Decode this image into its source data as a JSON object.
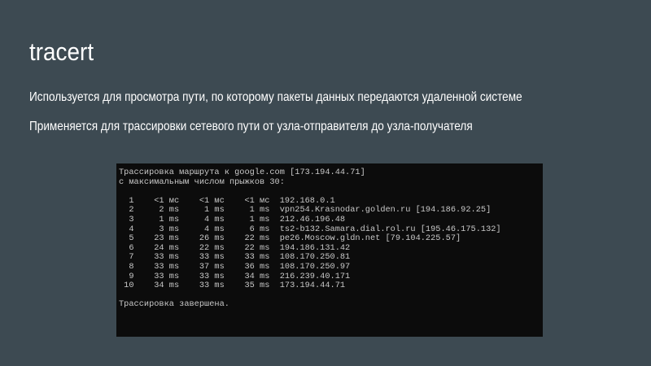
{
  "slide": {
    "title": "tracert",
    "bullets": [
      "Используется для просмотра пути, по которому пакеты данных передаются удаленной системе",
      "Применяется для трассировки сетевого пути от узла-отправителя до узла-получателя"
    ]
  },
  "console": {
    "lines": [
      "Трассировка маршрута к google.com [173.194.44.71]",
      "с максимальным числом прыжков 30:",
      "",
      "  1    <1 мс    <1 мс    <1 мс  192.168.0.1",
      "  2     2 ms     1 ms     1 ms  vpn254.Krasnodar.golden.ru [194.186.92.25]",
      "  3     1 ms     4 ms     1 ms  212.46.196.48",
      "  4     3 ms     4 ms     6 ms  ts2-b132.Samara.dial.rol.ru [195.46.175.132]",
      "  5    23 ms    26 ms    22 ms  pe26.Moscow.gldn.net [79.104.225.57]",
      "  6    24 ms    22 ms    22 ms  194.186.131.42",
      "  7    33 ms    33 ms    33 ms  108.170.250.81",
      "  8    33 ms    37 ms    36 ms  108.170.250.97",
      "  9    33 ms    33 ms    34 ms  216.239.40.171",
      " 10    34 ms    33 ms    35 ms  173.194.44.71",
      "",
      "Трассировка завершена."
    ]
  },
  "colors": {
    "background": "#3d4a52",
    "text": "#ffffff",
    "console_background": "#0c0c0c",
    "console_text": "#c8c8c8"
  }
}
